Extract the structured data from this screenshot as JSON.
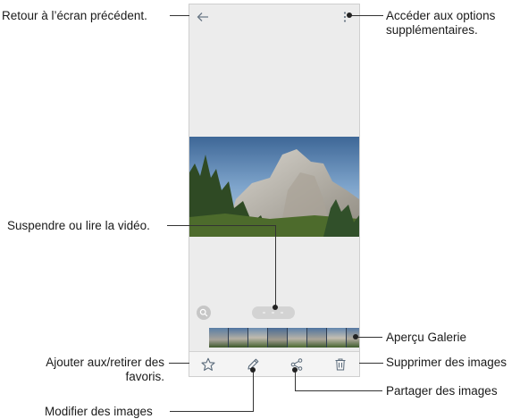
{
  "callouts": {
    "back": "Retour à l’écran précédent.",
    "options_line1": "Accéder aux options",
    "options_line2": "supplémentaires.",
    "pause_play": "Suspendre ou lire la vidéo.",
    "gallery_preview": "Aperçu Galerie",
    "favorites_line1": "Ajouter aux/retirer des",
    "favorites_line2": "favoris.",
    "delete": "Supprimer des images",
    "share": "Partager des images",
    "edit": "Modifier des images"
  },
  "icons": {
    "back": "arrow-left-icon",
    "more": "more-vertical-icon",
    "zoom": "magnifier-icon",
    "favorite": "star-icon",
    "edit": "pencil-icon",
    "share": "share-icon",
    "delete": "trash-icon"
  },
  "colors": {
    "icon": "#5a6a7a",
    "screen_bg": "#ececec",
    "sky": "#4f79a8",
    "foliage": "#3f5a2e"
  }
}
